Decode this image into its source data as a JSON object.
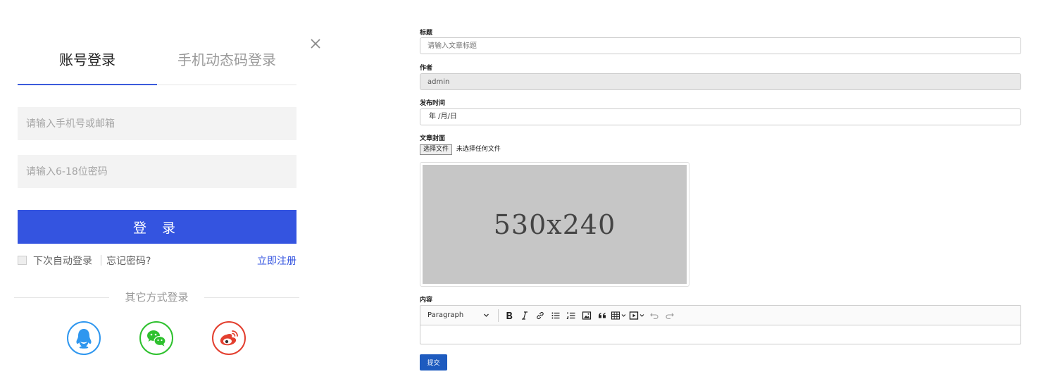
{
  "login": {
    "tabs": [
      {
        "label": "账号登录",
        "active": true
      },
      {
        "label": "手机动态码登录",
        "active": false
      }
    ],
    "account_placeholder": "请输入手机号或邮箱",
    "password_placeholder": "请输入6-18位密码",
    "submit_label": "登 录",
    "remember_label": "下次自动登录",
    "forgot_label": "忘记密码?",
    "register_label": "立即注册",
    "other_methods_label": "其它方式登录",
    "social": [
      {
        "name": "qq",
        "icon": "qq-icon",
        "color": "#2f97ef"
      },
      {
        "name": "wechat",
        "icon": "wechat-icon",
        "color": "#2ec12e"
      },
      {
        "name": "weibo",
        "icon": "weibo-icon",
        "color": "#e33f2f"
      }
    ],
    "accent_color": "#3454e0"
  },
  "article_form": {
    "title_label": "标题",
    "title_placeholder": "请输入文章标题",
    "author_label": "作者",
    "author_value": "admin",
    "date_label": "发布时间",
    "date_value": "年 /月/日",
    "cover_label": "文章封面",
    "file_button": "选择文件",
    "file_status": "未选择任何文件",
    "cover_placeholder_text": "530x240",
    "content_label": "内容",
    "toolbar": {
      "paragraph": "Paragraph",
      "buttons": [
        "bold-icon",
        "italic-icon",
        "link-icon",
        "bulleted-list-icon",
        "numbered-list-icon",
        "image-icon",
        "quote-icon",
        "table-icon",
        "media-icon",
        "undo-icon",
        "redo-icon"
      ]
    },
    "submit_label": "提交",
    "submit_color": "#1e5bbf"
  }
}
